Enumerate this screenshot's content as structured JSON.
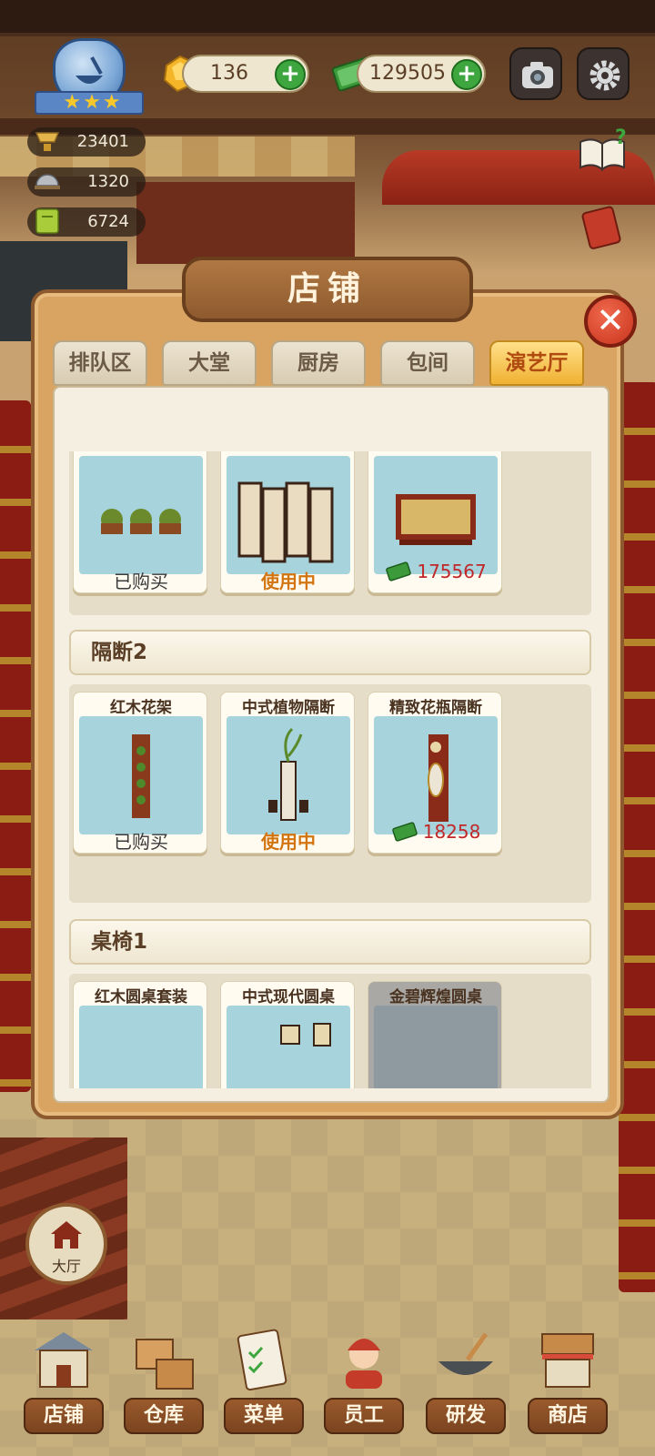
{
  "hud": {
    "gems": "136",
    "cash": "129505",
    "stats": [
      "23401",
      "1320",
      "6724"
    ]
  },
  "panel": {
    "title": "店铺",
    "tabs": [
      {
        "label": "排队区",
        "active": false
      },
      {
        "label": "大堂",
        "active": false
      },
      {
        "label": "厨房",
        "active": false
      },
      {
        "label": "包间",
        "active": false
      },
      {
        "label": "演艺厅",
        "active": true
      }
    ],
    "row0": [
      {
        "name": "",
        "status": "已购买",
        "type": "owned"
      },
      {
        "name": "",
        "status": "使用中",
        "type": "inuse"
      },
      {
        "name": "",
        "price": "175567",
        "type": "price"
      }
    ],
    "section1": "隔断2",
    "row1": [
      {
        "name": "红木花架",
        "status": "已购买",
        "type": "owned"
      },
      {
        "name": "中式植物隔断",
        "status": "使用中",
        "type": "inuse"
      },
      {
        "name": "精致花瓶隔断",
        "price": "18258",
        "type": "price"
      }
    ],
    "section2": "桌椅1",
    "row2": [
      {
        "name": "红木圆桌套装"
      },
      {
        "name": "中式现代圆桌"
      },
      {
        "name": "金碧辉煌圆桌"
      }
    ]
  },
  "hall_label": "大厅",
  "nav": [
    "店铺",
    "仓库",
    "菜单",
    "员工",
    "研发",
    "商店"
  ],
  "colors": {
    "accent": "#f0b232",
    "price": "#c0282a",
    "inuse": "#d27410",
    "plus": "#3ea63e"
  }
}
